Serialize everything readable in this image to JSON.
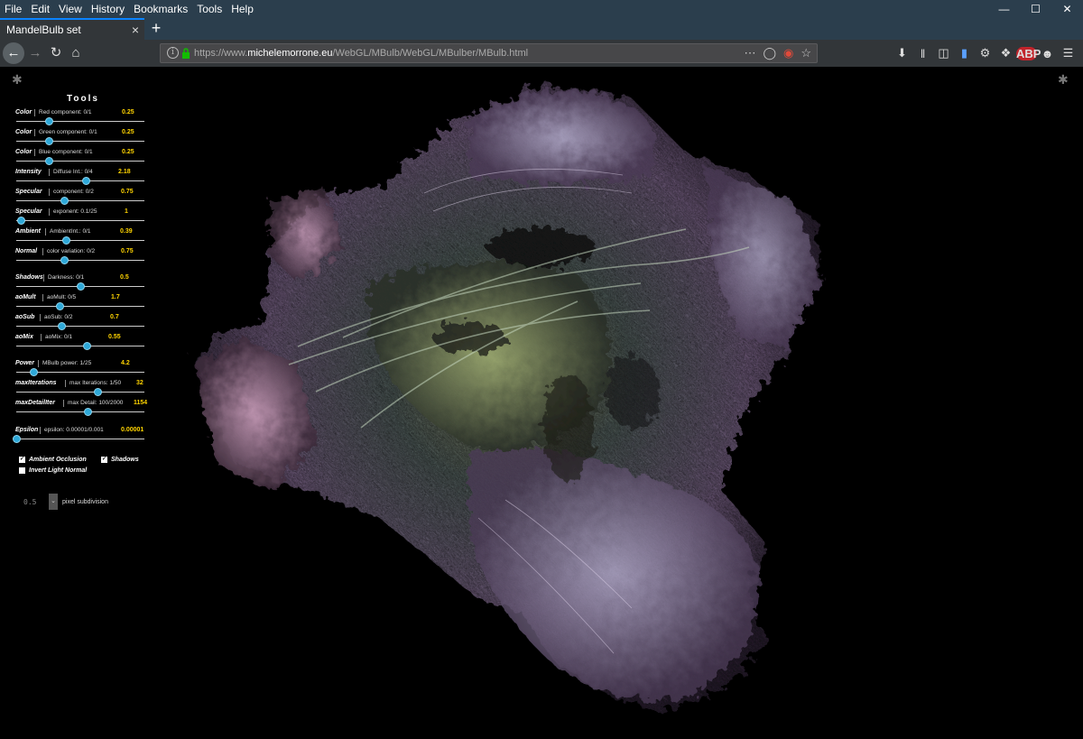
{
  "menu": [
    "File",
    "Edit",
    "View",
    "History",
    "Bookmarks",
    "Tools",
    "Help"
  ],
  "tab": {
    "title": "MandelBulb set",
    "close": "×"
  },
  "newtab": "+",
  "url": {
    "prefix": "https://www.",
    "host": "michelemorrone.eu",
    "path": "/WebGL/MBulb/WebGL/MBulber/MBulb.html"
  },
  "panel": {
    "title": "Tools",
    "controls": [
      {
        "name": "Color",
        "desc": "Red component: 0/1",
        "value": "0.25",
        "frac": 0.25
      },
      {
        "name": "Color",
        "desc": "Green component: 0/1",
        "value": "0.25",
        "frac": 0.25
      },
      {
        "name": "Color",
        "desc": "Blue component: 0/1",
        "value": "0.25",
        "frac": 0.25
      },
      {
        "name": "Intensity",
        "desc": "Diffuse Int.: 0/4",
        "value": "2.18",
        "frac": 0.545
      },
      {
        "name": "Specular",
        "desc": "component: 0/2",
        "value": "0.75",
        "frac": 0.375
      },
      {
        "name": "Specular",
        "desc": "exponent: 0.1/25",
        "value": "1",
        "frac": 0.036
      },
      {
        "name": "Ambient",
        "desc": "AmbientInt.: 0/1",
        "value": "0.39",
        "frac": 0.39
      },
      {
        "name": "Normal",
        "desc": "color variation: 0/2",
        "value": "0.75",
        "frac": 0.375
      },
      {
        "name": "Shadows",
        "desc": "Darkness: 0/1",
        "value": "0.5",
        "frac": 0.5
      },
      {
        "name": "aoMult",
        "desc": "aoMult: 0/5",
        "value": "1.7",
        "frac": 0.34
      },
      {
        "name": "aoSub",
        "desc": "aoSub: 0/2",
        "value": "0.7",
        "frac": 0.35
      },
      {
        "name": "aoMix",
        "desc": "aoMix: 0/1",
        "value": "0.55",
        "frac": 0.55
      },
      {
        "name": "Power",
        "desc": "MBulb power: 1/25",
        "value": "4.2",
        "frac": 0.133
      },
      {
        "name": "maxIterations",
        "desc": "max Iterations: 1/50",
        "value": "32",
        "frac": 0.633
      },
      {
        "name": "maxDetailIter",
        "desc": "max Detail: 100/2000",
        "value": "1154",
        "frac": 0.555
      },
      {
        "name": "Epsilon",
        "desc": "epsilon: 0.00001/0.001",
        "value": "0.00001",
        "frac": 0.0
      }
    ],
    "checks": {
      "ambient_occlusion": "Ambient Occlusion",
      "shadows": "Shadows",
      "invert_light_normal": "Invert Light Normal"
    },
    "subdivision": {
      "value": "0.5",
      "label": "pixel subdivision"
    }
  }
}
